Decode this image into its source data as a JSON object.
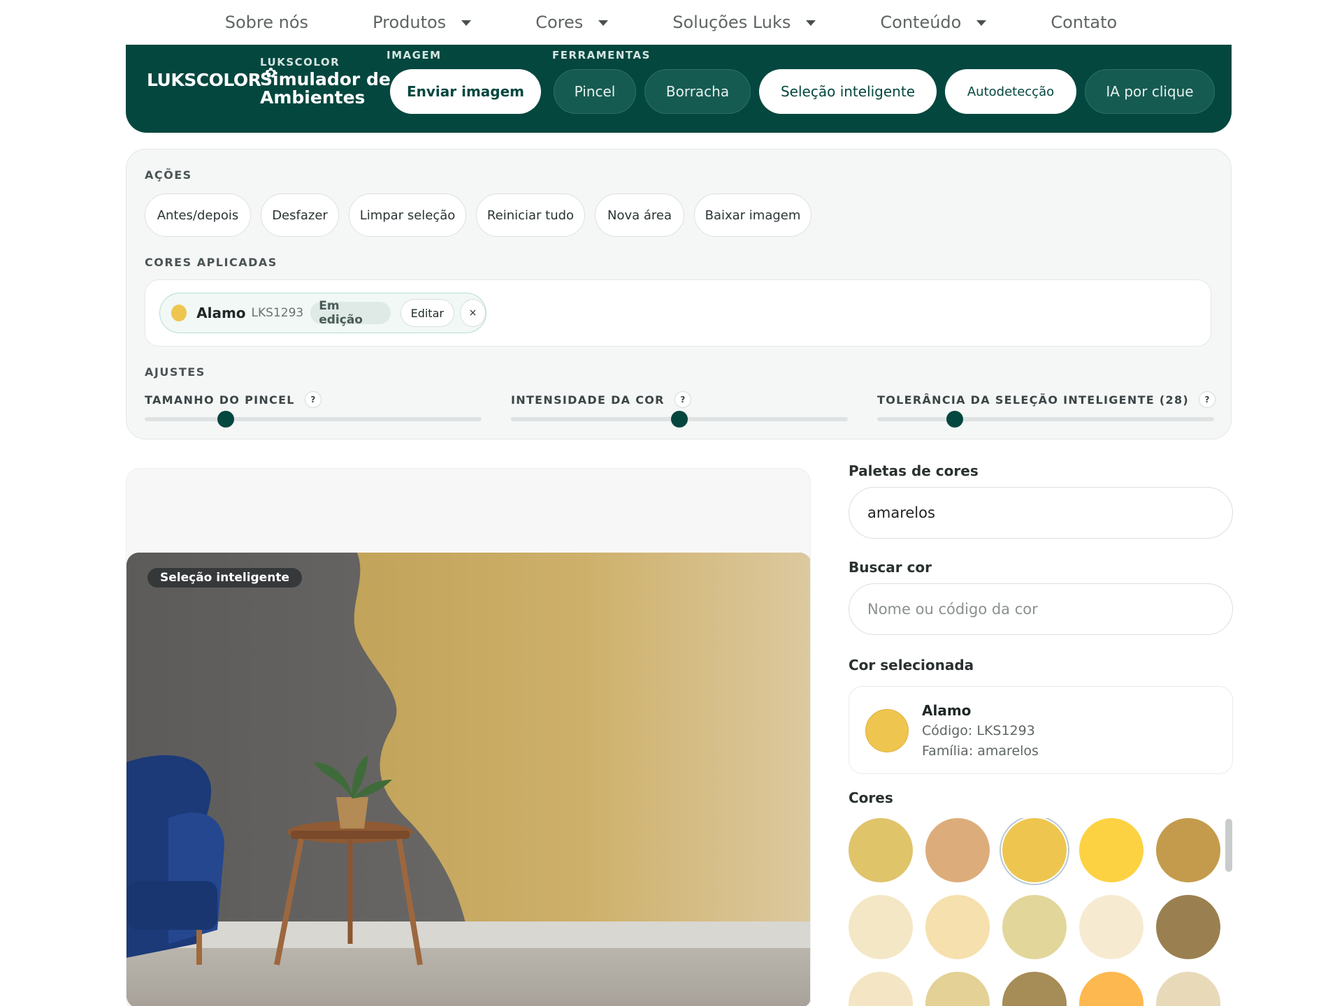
{
  "nav": {
    "items": [
      {
        "label": "Sobre nós",
        "dropdown": false
      },
      {
        "label": "Produtos",
        "dropdown": true
      },
      {
        "label": "Cores",
        "dropdown": true
      },
      {
        "label": "Soluções Luks",
        "dropdown": true
      },
      {
        "label": "Conteúdo",
        "dropdown": true
      },
      {
        "label": "Contato",
        "dropdown": false
      }
    ]
  },
  "toolbar": {
    "logo_text": "LUKSCOLOR",
    "brand_kicker": "LUKSCOLOR",
    "brand_title": "Simulador de Ambientes",
    "image_label": "IMAGEM",
    "upload_button": "Enviar imagem",
    "tools_label": "FERRAMENTAS",
    "tools": [
      "Pincel",
      "Borracha",
      "Seleção inteligente",
      "Autodetecção",
      "IA por clique"
    ],
    "active_tools": [
      "Seleção inteligente",
      "Autodetecção"
    ],
    "accent": "#04473f"
  },
  "actions": {
    "label": "AÇÕES",
    "buttons": [
      "Antes/depois",
      "Desfazer",
      "Limpar seleção",
      "Reiniciar tudo",
      "Nova área",
      "Baixar imagem"
    ]
  },
  "applied": {
    "label": "CORES APLICADAS",
    "chip": {
      "name": "Alamo",
      "code": "LKS1293",
      "status": "Em edição",
      "edit_label": "Editar",
      "close_label": "×",
      "color": "#eec54f"
    }
  },
  "adjustments": {
    "label": "AJUSTES",
    "help_glyph": "?",
    "sliders": [
      {
        "label": "TAMANHO DO PINCEL",
        "value_fraction": 0.24
      },
      {
        "label": "INTENSIDADE DA COR",
        "value_fraction": 0.5
      },
      {
        "label": "TOLERÂNCIA DA SELEÇÃO INTELIGENTE (28)",
        "value_fraction": 0.23
      }
    ]
  },
  "preview": {
    "mode_tag": "Seleção inteligente"
  },
  "sidebar": {
    "palette_label": "Paletas de cores",
    "palette_value": "amarelos",
    "search_label": "Buscar cor",
    "search_placeholder": "Nome ou código da cor",
    "selected_label": "Cor selecionada",
    "selected": {
      "name": "Alamo",
      "code_line": "Código: LKS1293",
      "family_line": "Família: amarelos",
      "color": "#eec54f"
    },
    "colors_label": "Cores",
    "swatches": [
      "#dfc46a",
      "#dcad7b",
      "#eec54f",
      "#fdd242",
      "#c49b4c",
      "#f4e7c6",
      "#f6e0ad",
      "#e2d69a",
      "#f6ebd1",
      "#9a8050",
      "#f4e6c4",
      "#e3d196",
      "#a68c56",
      "#fdb94f",
      "#e8d9b9"
    ],
    "selected_swatch_index": 2
  }
}
